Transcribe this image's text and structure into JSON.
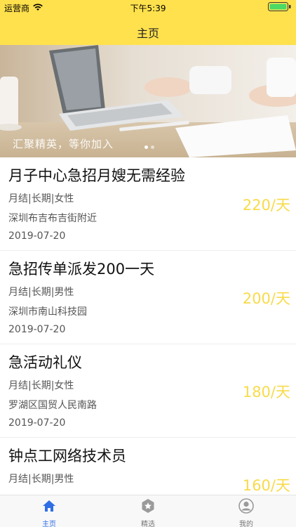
{
  "status_bar": {
    "carrier": "运营商",
    "time": "下午5:39"
  },
  "nav": {
    "title": "主页"
  },
  "banner": {
    "caption": "汇聚精英，等你加入"
  },
  "jobs": [
    {
      "title": "月子中心急招月嫂无需经验",
      "meta": "月结|长期|女性",
      "location": "深圳布吉布吉街附近",
      "date": "2019-07-20",
      "salary": "220/天"
    },
    {
      "title": "急招传单派发200一天",
      "meta": "月结|长期|男性",
      "location": "深圳市南山科技园",
      "date": "2019-07-20",
      "salary": "200/天"
    },
    {
      "title": "急活动礼仪",
      "meta": "月结|长期|女性",
      "location": "罗湖区国贸人民南路",
      "date": "2019-07-20",
      "salary": "180/天"
    },
    {
      "title": "钟点工网络技术员",
      "meta": "月结|长期|男性",
      "location": "",
      "date": "",
      "salary": "160/天"
    }
  ],
  "tabbar": {
    "items": [
      {
        "label": "主页",
        "icon": "home-icon",
        "active": true
      },
      {
        "label": "精选",
        "icon": "star-badge-icon",
        "active": false
      },
      {
        "label": "我的",
        "icon": "user-icon",
        "active": false
      }
    ]
  },
  "colors": {
    "brand_yellow": "#FFE14D",
    "salary_yellow": "#F8DB4A",
    "tab_active": "#2F6FE6"
  }
}
